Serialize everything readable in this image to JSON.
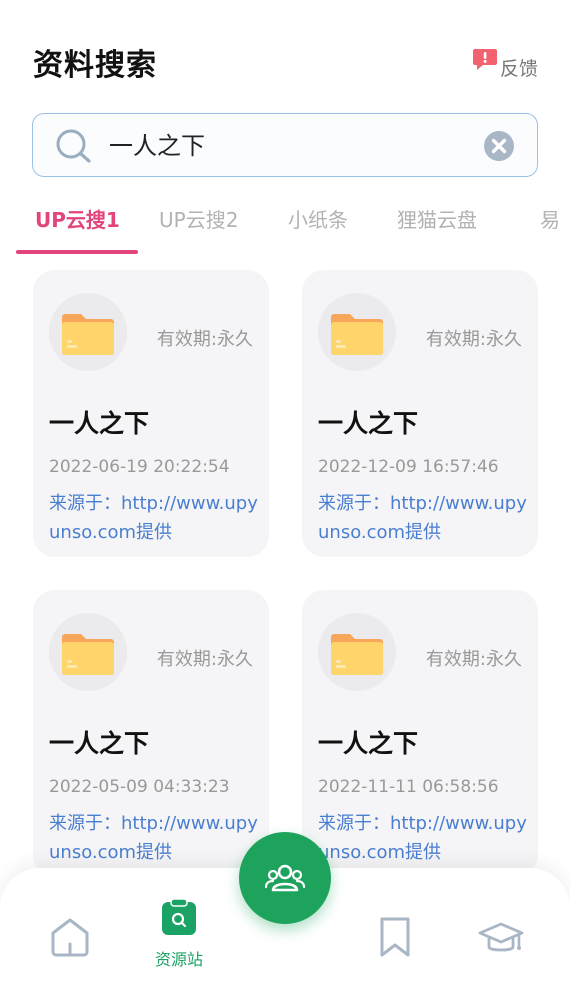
{
  "header": {
    "title": "资料搜索",
    "feedback_label": "反馈",
    "feedback_icon": "feedback-alert-icon"
  },
  "search": {
    "value": "一人之下",
    "icon": "search-icon",
    "clear_icon": "clear-icon"
  },
  "tabs": [
    {
      "label": "UP云搜1",
      "active": true
    },
    {
      "label": "UP云搜2",
      "active": false
    },
    {
      "label": "小纸条",
      "active": false
    },
    {
      "label": "狸猫云盘",
      "active": false
    },
    {
      "label": "易",
      "active": false
    }
  ],
  "results": [
    {
      "validity": "有效期:永久",
      "title": "一人之下",
      "date": "2022-06-19 20:22:54",
      "source": "来源于：http://www.upyunso.com提供"
    },
    {
      "validity": "有效期:永久",
      "title": "一人之下",
      "date": "2022-12-09 16:57:46",
      "source": "来源于：http://www.upyunso.com提供"
    },
    {
      "validity": "有效期:永久",
      "title": "一人之下",
      "date": "2022-05-09 04:33:23",
      "source": "来源于：http://www.upyunso.com提供"
    },
    {
      "validity": "有效期:永久",
      "title": "一人之下",
      "date": "2022-11-11 06:58:56",
      "source": "来源于：http://www.upyunso.com提供"
    }
  ],
  "bottom_nav": {
    "home_icon": "home-icon",
    "resource_label": "资源站",
    "resource_icon": "clipboard-search-icon",
    "fab_icon": "community-icon",
    "bookmark_icon": "bookmark-icon",
    "study_icon": "graduation-cap-icon"
  },
  "colors": {
    "accent_pink": "#e2457d",
    "brand_green": "#1ea35c",
    "link_blue": "#4a7ed0",
    "folder_yellow": "#ffd46a"
  }
}
